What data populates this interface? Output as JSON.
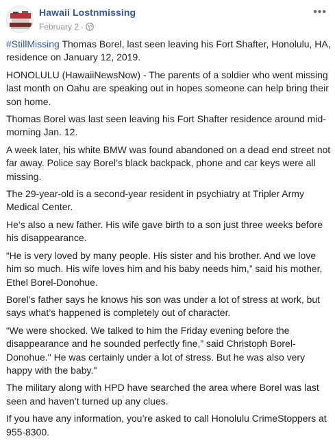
{
  "post": {
    "page_name": "Hawaii Lostnmissing",
    "date": "February 2",
    "separator": "·",
    "more_label": "•••",
    "hashtag": "#StillMissing",
    "intro": " Thomas Borel, last seen leaving his Fort Shafter, Honolulu, HA, residence on January 12, 2019.",
    "paragraphs": [
      "HONOLULU (HawaiiNewsNow) - The parents of a soldier who went missing last month on Oahu are speaking out in hopes someone can help bring their son home.",
      "Thomas Borel was last seen leaving his Fort Shafter residence around mid-morning Jan. 12.",
      "A week later, his white BMW was found abandoned on a dead end street not far away. Police say Borel’s black backpack, phone and car keys were all missing.",
      "The 29-year-old is a second-year resident in psychiatry at Tripler Army Medical Center.",
      "He’s also a new father. His wife gave birth to a son just three weeks before his disappearance.",
      "“He is very loved by many people. His sister and his brother. And we love him so much. His wife loves him and his baby needs him,” said his mother, Ethel Borel-Donohue.",
      "Borel’s father says he knows his son was under a lot of stress at work, but says what’s happened is completely out of character.",
      "“We were shocked. We talked to him the Friday evening before the disappearance and he sounded perfectly fine,” said Christoph Borel-Donohue.\" He was certainly under a lot of stress. But he was also very happy with the baby.\"",
      "The military along with HPD have searched the area where Borel was last seen and haven’t turned up any clues.",
      "If you have any information, you’re asked to call Honolulu CrimeStoppers at 955-8300."
    ],
    "privacy_icon": "globe-icon",
    "colors": {
      "link": "#385898",
      "meta": "#90949c",
      "text": "#1c1e21"
    }
  }
}
